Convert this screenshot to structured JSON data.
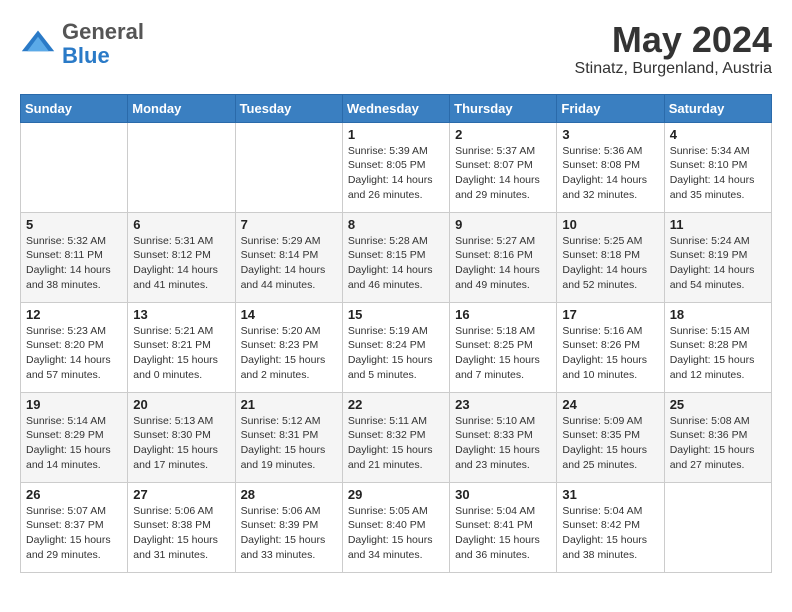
{
  "header": {
    "logo_general": "General",
    "logo_blue": "Blue",
    "month_title": "May 2024",
    "subtitle": "Stinatz, Burgenland, Austria"
  },
  "days_of_week": [
    "Sunday",
    "Monday",
    "Tuesday",
    "Wednesday",
    "Thursday",
    "Friday",
    "Saturday"
  ],
  "weeks": [
    [
      {
        "day": "",
        "sunrise": "",
        "sunset": "",
        "daylight": ""
      },
      {
        "day": "",
        "sunrise": "",
        "sunset": "",
        "daylight": ""
      },
      {
        "day": "",
        "sunrise": "",
        "sunset": "",
        "daylight": ""
      },
      {
        "day": "1",
        "sunrise": "Sunrise: 5:39 AM",
        "sunset": "Sunset: 8:05 PM",
        "daylight": "Daylight: 14 hours and 26 minutes."
      },
      {
        "day": "2",
        "sunrise": "Sunrise: 5:37 AM",
        "sunset": "Sunset: 8:07 PM",
        "daylight": "Daylight: 14 hours and 29 minutes."
      },
      {
        "day": "3",
        "sunrise": "Sunrise: 5:36 AM",
        "sunset": "Sunset: 8:08 PM",
        "daylight": "Daylight: 14 hours and 32 minutes."
      },
      {
        "day": "4",
        "sunrise": "Sunrise: 5:34 AM",
        "sunset": "Sunset: 8:10 PM",
        "daylight": "Daylight: 14 hours and 35 minutes."
      }
    ],
    [
      {
        "day": "5",
        "sunrise": "Sunrise: 5:32 AM",
        "sunset": "Sunset: 8:11 PM",
        "daylight": "Daylight: 14 hours and 38 minutes."
      },
      {
        "day": "6",
        "sunrise": "Sunrise: 5:31 AM",
        "sunset": "Sunset: 8:12 PM",
        "daylight": "Daylight: 14 hours and 41 minutes."
      },
      {
        "day": "7",
        "sunrise": "Sunrise: 5:29 AM",
        "sunset": "Sunset: 8:14 PM",
        "daylight": "Daylight: 14 hours and 44 minutes."
      },
      {
        "day": "8",
        "sunrise": "Sunrise: 5:28 AM",
        "sunset": "Sunset: 8:15 PM",
        "daylight": "Daylight: 14 hours and 46 minutes."
      },
      {
        "day": "9",
        "sunrise": "Sunrise: 5:27 AM",
        "sunset": "Sunset: 8:16 PM",
        "daylight": "Daylight: 14 hours and 49 minutes."
      },
      {
        "day": "10",
        "sunrise": "Sunrise: 5:25 AM",
        "sunset": "Sunset: 8:18 PM",
        "daylight": "Daylight: 14 hours and 52 minutes."
      },
      {
        "day": "11",
        "sunrise": "Sunrise: 5:24 AM",
        "sunset": "Sunset: 8:19 PM",
        "daylight": "Daylight: 14 hours and 54 minutes."
      }
    ],
    [
      {
        "day": "12",
        "sunrise": "Sunrise: 5:23 AM",
        "sunset": "Sunset: 8:20 PM",
        "daylight": "Daylight: 14 hours and 57 minutes."
      },
      {
        "day": "13",
        "sunrise": "Sunrise: 5:21 AM",
        "sunset": "Sunset: 8:21 PM",
        "daylight": "Daylight: 15 hours and 0 minutes."
      },
      {
        "day": "14",
        "sunrise": "Sunrise: 5:20 AM",
        "sunset": "Sunset: 8:23 PM",
        "daylight": "Daylight: 15 hours and 2 minutes."
      },
      {
        "day": "15",
        "sunrise": "Sunrise: 5:19 AM",
        "sunset": "Sunset: 8:24 PM",
        "daylight": "Daylight: 15 hours and 5 minutes."
      },
      {
        "day": "16",
        "sunrise": "Sunrise: 5:18 AM",
        "sunset": "Sunset: 8:25 PM",
        "daylight": "Daylight: 15 hours and 7 minutes."
      },
      {
        "day": "17",
        "sunrise": "Sunrise: 5:16 AM",
        "sunset": "Sunset: 8:26 PM",
        "daylight": "Daylight: 15 hours and 10 minutes."
      },
      {
        "day": "18",
        "sunrise": "Sunrise: 5:15 AM",
        "sunset": "Sunset: 8:28 PM",
        "daylight": "Daylight: 15 hours and 12 minutes."
      }
    ],
    [
      {
        "day": "19",
        "sunrise": "Sunrise: 5:14 AM",
        "sunset": "Sunset: 8:29 PM",
        "daylight": "Daylight: 15 hours and 14 minutes."
      },
      {
        "day": "20",
        "sunrise": "Sunrise: 5:13 AM",
        "sunset": "Sunset: 8:30 PM",
        "daylight": "Daylight: 15 hours and 17 minutes."
      },
      {
        "day": "21",
        "sunrise": "Sunrise: 5:12 AM",
        "sunset": "Sunset: 8:31 PM",
        "daylight": "Daylight: 15 hours and 19 minutes."
      },
      {
        "day": "22",
        "sunrise": "Sunrise: 5:11 AM",
        "sunset": "Sunset: 8:32 PM",
        "daylight": "Daylight: 15 hours and 21 minutes."
      },
      {
        "day": "23",
        "sunrise": "Sunrise: 5:10 AM",
        "sunset": "Sunset: 8:33 PM",
        "daylight": "Daylight: 15 hours and 23 minutes."
      },
      {
        "day": "24",
        "sunrise": "Sunrise: 5:09 AM",
        "sunset": "Sunset: 8:35 PM",
        "daylight": "Daylight: 15 hours and 25 minutes."
      },
      {
        "day": "25",
        "sunrise": "Sunrise: 5:08 AM",
        "sunset": "Sunset: 8:36 PM",
        "daylight": "Daylight: 15 hours and 27 minutes."
      }
    ],
    [
      {
        "day": "26",
        "sunrise": "Sunrise: 5:07 AM",
        "sunset": "Sunset: 8:37 PM",
        "daylight": "Daylight: 15 hours and 29 minutes."
      },
      {
        "day": "27",
        "sunrise": "Sunrise: 5:06 AM",
        "sunset": "Sunset: 8:38 PM",
        "daylight": "Daylight: 15 hours and 31 minutes."
      },
      {
        "day": "28",
        "sunrise": "Sunrise: 5:06 AM",
        "sunset": "Sunset: 8:39 PM",
        "daylight": "Daylight: 15 hours and 33 minutes."
      },
      {
        "day": "29",
        "sunrise": "Sunrise: 5:05 AM",
        "sunset": "Sunset: 8:40 PM",
        "daylight": "Daylight: 15 hours and 34 minutes."
      },
      {
        "day": "30",
        "sunrise": "Sunrise: 5:04 AM",
        "sunset": "Sunset: 8:41 PM",
        "daylight": "Daylight: 15 hours and 36 minutes."
      },
      {
        "day": "31",
        "sunrise": "Sunrise: 5:04 AM",
        "sunset": "Sunset: 8:42 PM",
        "daylight": "Daylight: 15 hours and 38 minutes."
      },
      {
        "day": "",
        "sunrise": "",
        "sunset": "",
        "daylight": ""
      }
    ]
  ]
}
